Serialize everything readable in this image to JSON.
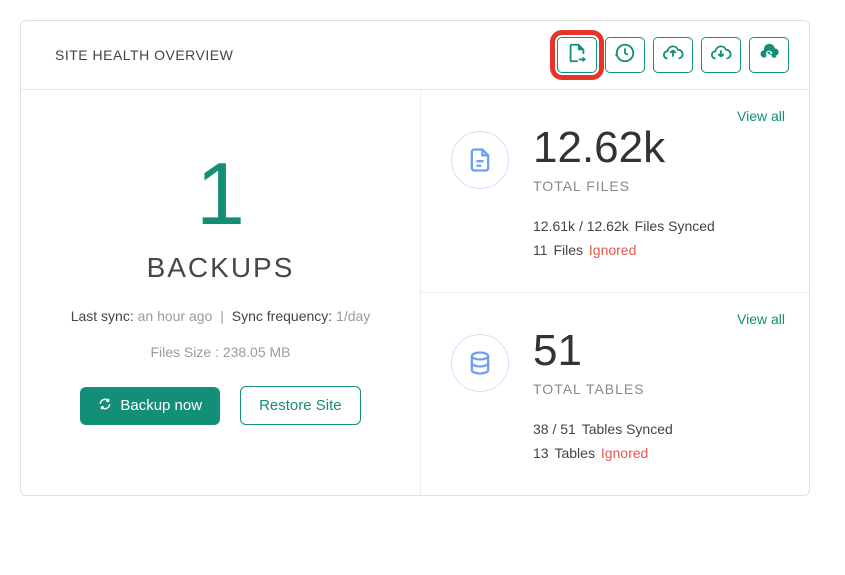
{
  "header": {
    "title": "SITE HEALTH OVERVIEW"
  },
  "backups": {
    "count": "1",
    "label": "BACKUPS",
    "last_sync_label": "Last sync:",
    "last_sync_value": "an hour ago",
    "sync_freq_label": "Sync frequency:",
    "sync_freq_value": "1/day",
    "files_size_label": "Files Size :",
    "files_size_value": "238.05 MB",
    "backup_now_label": "Backup now",
    "restore_label": "Restore Site"
  },
  "files": {
    "view_all": "View all",
    "total": "12.62k",
    "total_label": "TOTAL FILES",
    "synced_current": "12.61k",
    "synced_total": "12.62k",
    "synced_suffix": "Files Synced",
    "ignored_count": "11",
    "ignored_unit": "Files",
    "ignored_word": "Ignored"
  },
  "tables": {
    "view_all": "View all",
    "total": "51",
    "total_label": "TOTAL TABLES",
    "synced_current": "38",
    "synced_total": "51",
    "synced_suffix": "Tables Synced",
    "ignored_count": "13",
    "ignored_unit": "Tables",
    "ignored_word": "Ignored"
  }
}
